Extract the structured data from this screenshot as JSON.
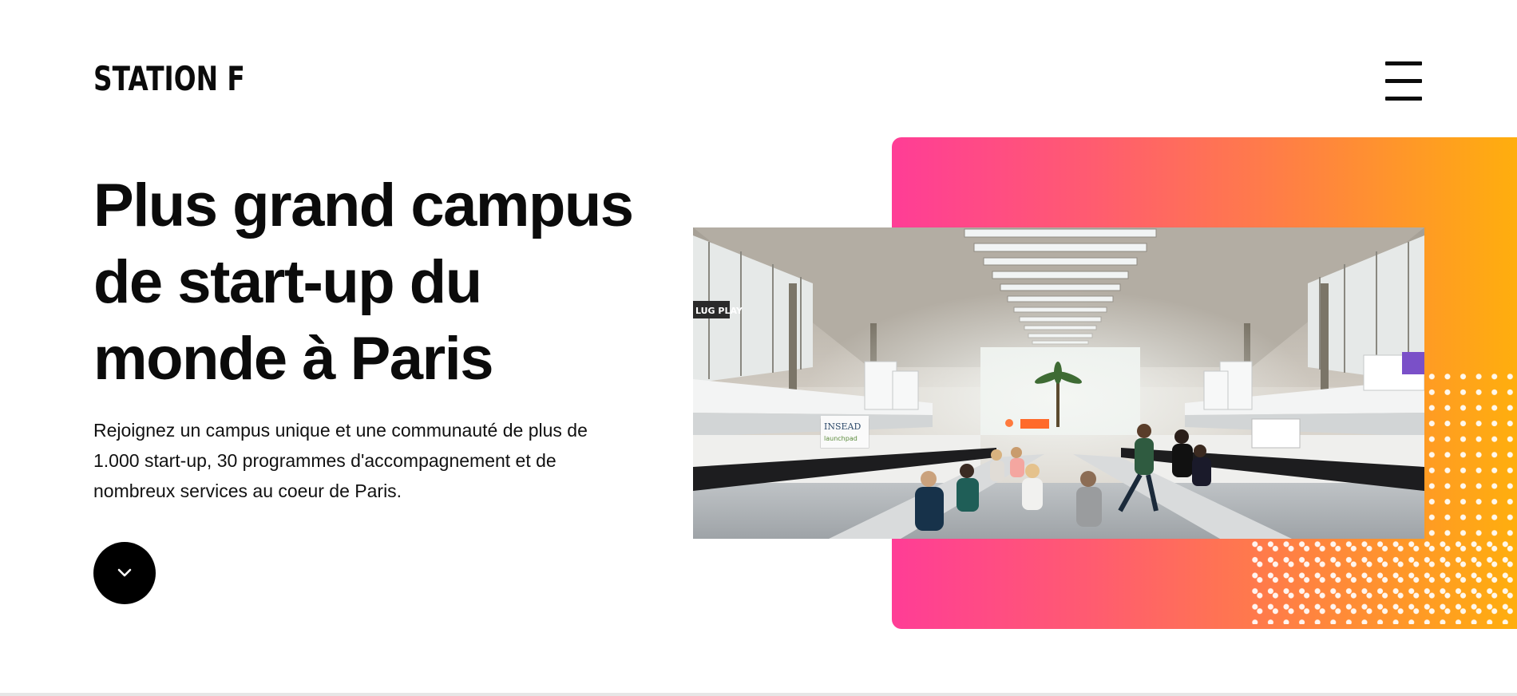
{
  "header": {
    "logo_text": "STATION F",
    "menu_icon": "hamburger-menu-icon"
  },
  "hero": {
    "title": "Plus grand campus de start-up du monde à Paris",
    "description": "Rejoignez un campus unique et une communauté de plus de 1.000 start-up, 30 programmes d'accompagnement et de nombreux services au coeur de Paris.",
    "scroll_icon": "chevron-down-icon"
  },
  "visual": {
    "gradient_colors": [
      "#ff3d96",
      "#ff5a72",
      "#ff8340",
      "#ffb10a"
    ],
    "photo_signs": {
      "left_sign": "LUG PLAY",
      "insead_sign": "INSEAD",
      "launch_sign": "launchpad"
    }
  }
}
